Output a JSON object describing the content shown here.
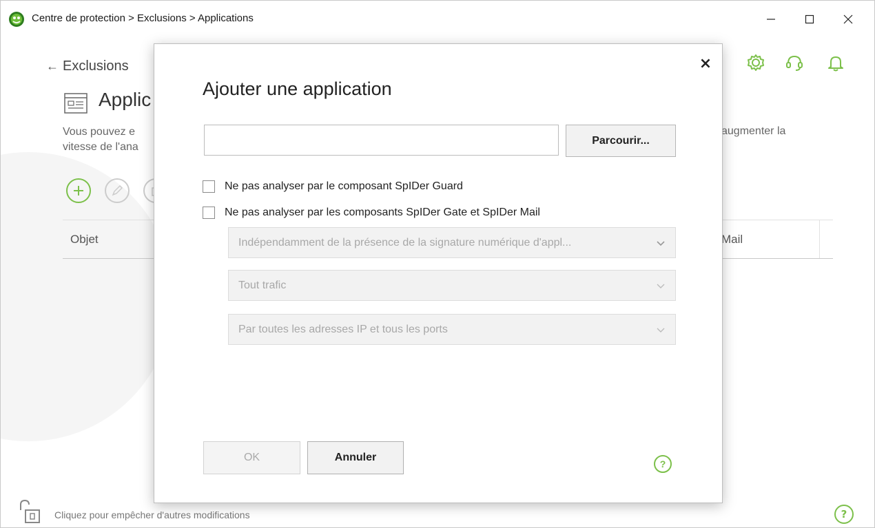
{
  "window": {
    "breadcrumb_title": "Centre de protection > Exclusions > Applications",
    "minimize_glyph": "—",
    "maximize_glyph": "☐",
    "close_glyph": "✕"
  },
  "background_page": {
    "back_link_label": "Exclusions",
    "page_title": "Applic",
    "description_left": "Vous pouvez e\nvitesse de l'ana",
    "description_right": "augmenter la",
    "table": {
      "col_object": "Objet",
      "col_mail": "Mail"
    },
    "footer_text": "Cliquez pour empêcher d'autres modifications",
    "footer_help_glyph": "?",
    "header_icons": [
      "gear-icon",
      "support-headset-icon",
      "bell-icon"
    ]
  },
  "dialog": {
    "title": "Ajouter une application",
    "close_glyph": "×",
    "path_input_value": "",
    "browse_label": "Parcourir...",
    "checkbox_spider_guard": "Ne pas analyser par le composant SpIDer Guard",
    "checkbox_spider_gate_mail": "Ne pas analyser par les composants SpIDer Gate et SpIDer Mail",
    "select_signature": "Indépendamment de la présence de la signature numérique d'appl...",
    "select_traffic": "Tout trafic",
    "select_addresses": "Par toutes les adresses IP et tous les ports",
    "ok_label": "OK",
    "cancel_label": "Annuler",
    "help_glyph": "?"
  },
  "colors": {
    "accent_green": "#7cc04a",
    "disabled_gray": "#a8a8a8"
  }
}
